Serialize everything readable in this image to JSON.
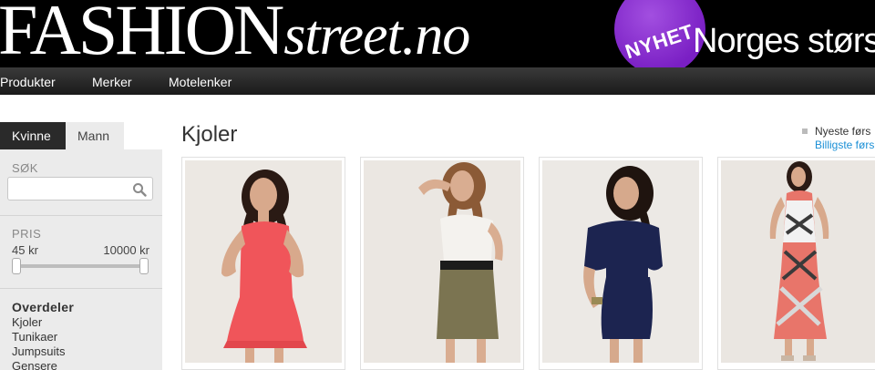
{
  "header": {
    "logo_main": "FASHION",
    "logo_suffix": "street.no",
    "badge": "NYHET",
    "tagline": "Norges største",
    "badge_color": "#8e2fd6"
  },
  "nav": {
    "items": [
      "Produkter",
      "Merker",
      "Motelenker"
    ]
  },
  "sidebar": {
    "tabs": [
      "Kvinne",
      "Mann"
    ],
    "active_tab": "Kvinne",
    "search": {
      "label": "SØK",
      "value": "",
      "icon": "search-icon"
    },
    "price": {
      "label": "PRIS",
      "min": "45 kr",
      "max": "10000 kr",
      "range_low": 0,
      "range_high": 1
    },
    "category": {
      "heading": "Overdeler",
      "items": [
        "Kjoler",
        "Tunikaer",
        "Jumpsuits",
        "Gensere"
      ]
    }
  },
  "main": {
    "title": "Kjoler",
    "sort": {
      "active": "Nyeste førs",
      "option": "Billigste førs"
    },
    "products": [
      {
        "name": "",
        "dress_color": "#f0555a"
      },
      {
        "name": "",
        "dress_color": "#7b7451"
      },
      {
        "name": "",
        "dress_color": "#1c2450"
      },
      {
        "name": "",
        "dress_color": "#e8756a"
      }
    ]
  }
}
